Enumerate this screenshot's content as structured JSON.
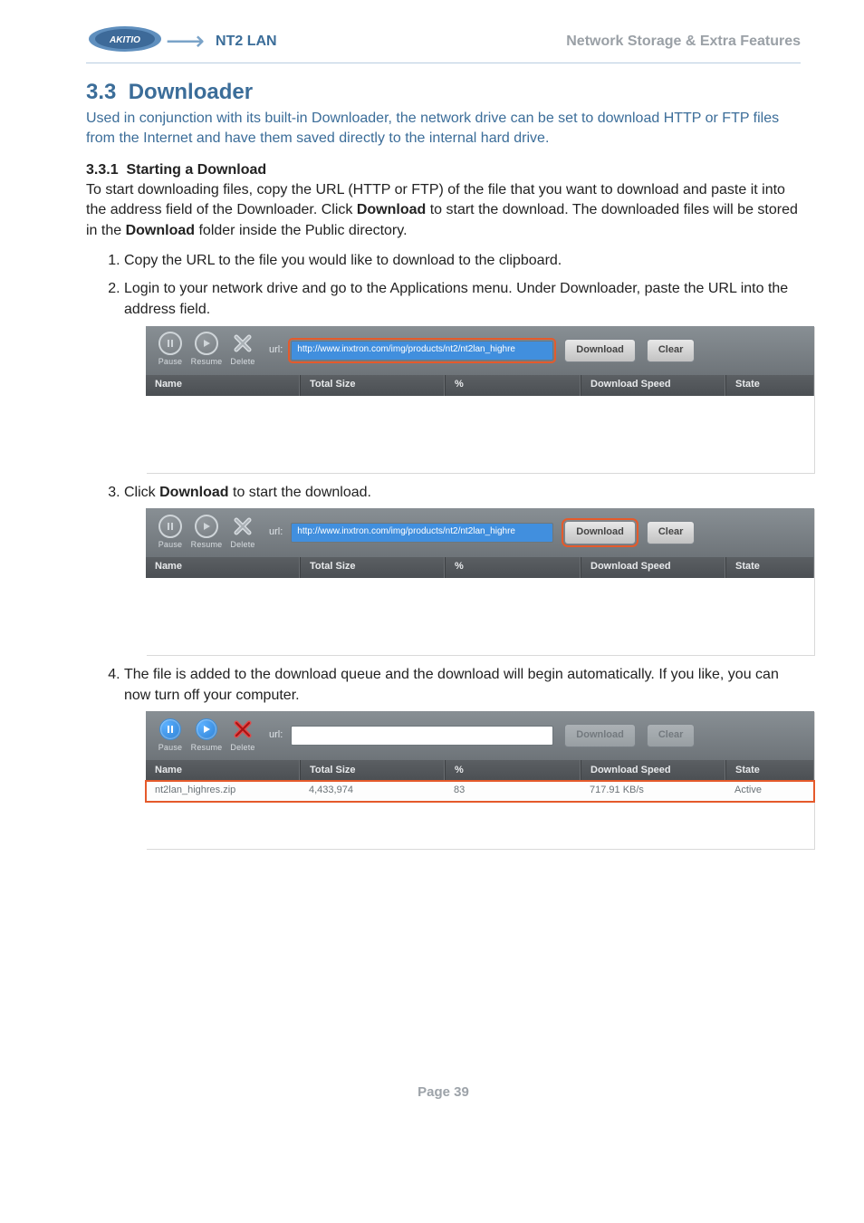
{
  "header": {
    "brand_text": "AKITIO",
    "product": "NT2 LAN",
    "right_title": "Network Storage & Extra Features"
  },
  "section": {
    "number": "3.3",
    "title": "Downloader",
    "intro": "Used in conjunction with its built-in Downloader, the network drive can be set to download HTTP or FTP files from the Internet and have them saved directly to the internal hard drive."
  },
  "subsection": {
    "number": "3.3.1",
    "title": "Starting a Download",
    "para_parts": [
      "To start downloading files, copy the URL (HTTP or FTP) of the file that you want to download and paste it into the address field of the Downloader. Click ",
      "Download",
      " to start the download. The downloaded files will be stored in the ",
      "Download",
      " folder inside the Public directory."
    ]
  },
  "steps": {
    "s1": "Copy the URL to the file you would like to download to the clipboard.",
    "s2": "Login to your network drive and go to the Applications menu. Under Downloader, paste the URL into the address field.",
    "s3_pre": "Click ",
    "s3_bold": "Download",
    "s3_post": " to start the download.",
    "s4": "The file is added to the download queue and the download will begin automatically. If you like, you can now turn off your computer."
  },
  "downloader": {
    "labels": {
      "pause": "Pause",
      "resume": "Resume",
      "delete": "Delete",
      "url": "url:",
      "download_btn": "Download",
      "clear_btn": "Clear"
    },
    "columns": {
      "name": "Name",
      "total_size": "Total Size",
      "percent": "%",
      "download_speed": "Download Speed",
      "state": "State"
    },
    "url_value_full": "http://www.inxtron.com/img/products/nt2/nt2lan_highre",
    "row": {
      "name": "nt2lan_highres.zip",
      "size": "4,433,974",
      "pct": "83",
      "speed": "717.91 KB/s",
      "state": "Active"
    }
  },
  "footer": {
    "page": "Page 39"
  }
}
